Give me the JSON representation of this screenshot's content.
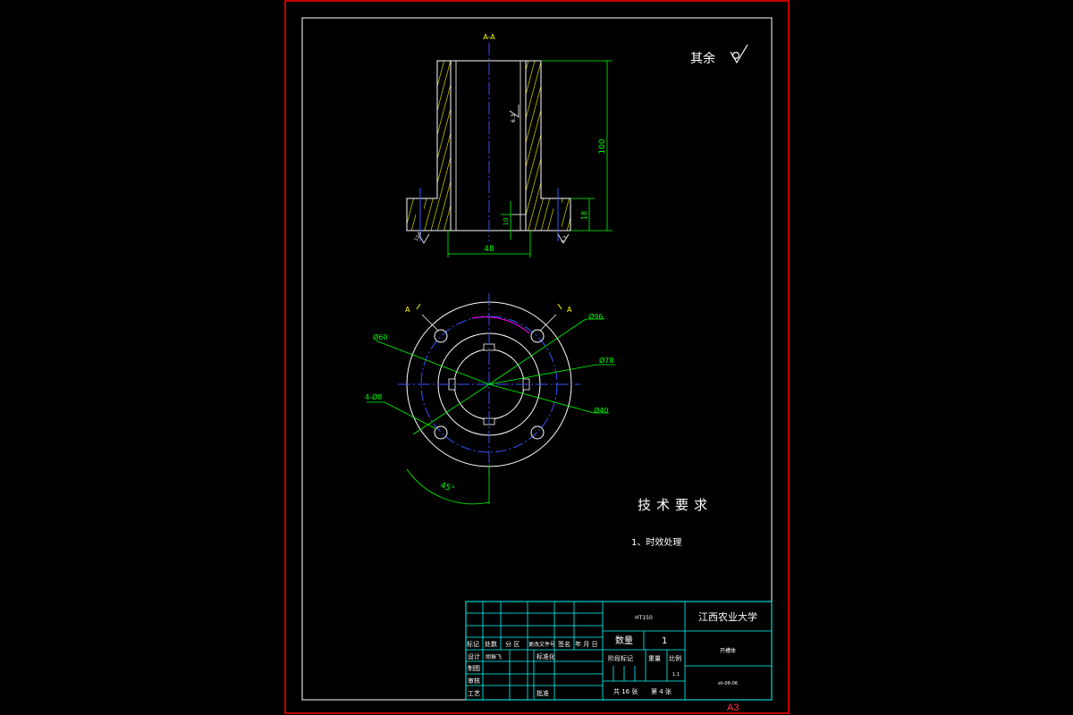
{
  "drawing": {
    "section_label": "A-A",
    "roughness_note": "其余",
    "tech_title": "技术要求",
    "tech_item": "1、时效处理",
    "sheet_size": "A3"
  },
  "section_dims": {
    "height_total": "100",
    "flange_thickness": "18",
    "bore_depth": "10",
    "bore_width": "48",
    "roughness_inner": "6.3",
    "roughness_left": "12.5",
    "roughness_right": "6.3"
  },
  "plan_view": {
    "cut_left": "A",
    "cut_right": "A",
    "dia_96": "Ø96",
    "dia_60": "Ø60",
    "dia_78": "Ø78",
    "holes": "4-Ø8",
    "dia_40": "Ø40",
    "angle": "45°"
  },
  "title_block": {
    "material": "HT150",
    "school": "江西农业大学",
    "qty_label": "数量",
    "qty_value": "1",
    "part_name": "开槽体",
    "stage_label": "阶段标记",
    "weight_label": "重量",
    "scale_label": "比例",
    "scale_value": "1:1",
    "sheets": "共 16 张",
    "sheet_no": "第 4 张",
    "drawing_no": "sh-08-06",
    "row_labels": [
      "标记",
      "处数",
      "分 区",
      "更改文件号",
      "签名",
      "年 月 日"
    ],
    "design_label": "设计",
    "designer": "胡振飞",
    "std_label": "标准化",
    "draw_label": "制图",
    "check_label": "审核",
    "process_label": "工艺",
    "approve_label": "批准"
  }
}
